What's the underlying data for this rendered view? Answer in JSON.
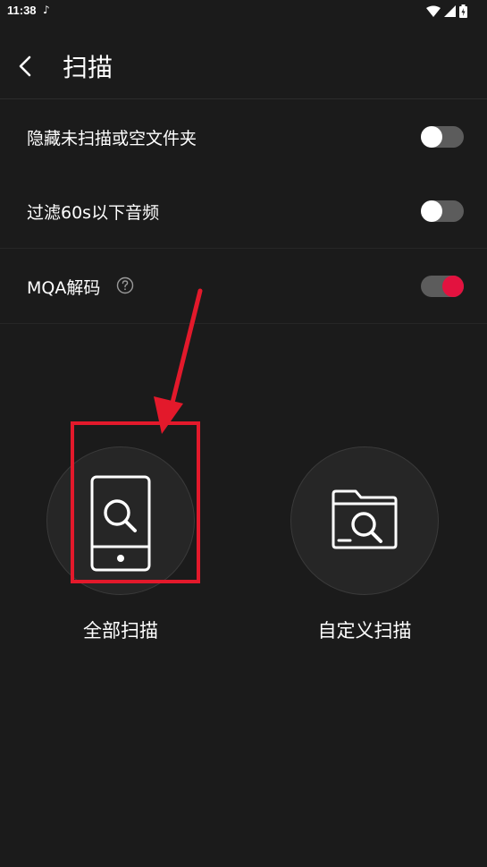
{
  "status_bar": {
    "time": "11:38",
    "note_icon": "music-note-icon",
    "wifi_icon": "wifi-icon",
    "signal_icon": "signal-icon",
    "battery_icon": "battery-icon"
  },
  "header": {
    "back_icon": "chevron-left-icon",
    "title": "扫描"
  },
  "settings": [
    {
      "label": "隐藏未扫描或空文件夹",
      "toggle": "off"
    },
    {
      "label": "过滤60s以下音频",
      "toggle": "off"
    },
    {
      "label": "MQA解码",
      "help_icon": "question-circle-icon",
      "toggle": "on"
    }
  ],
  "scan_options": [
    {
      "label": "全部扫描",
      "icon": "phone-search-icon"
    },
    {
      "label": "自定义扫描",
      "icon": "folder-search-icon"
    }
  ],
  "colors": {
    "background": "#1b1b1b",
    "accent": "#e3123f",
    "annotation": "#e3192b",
    "toggle_track": "#5c5c5c"
  }
}
